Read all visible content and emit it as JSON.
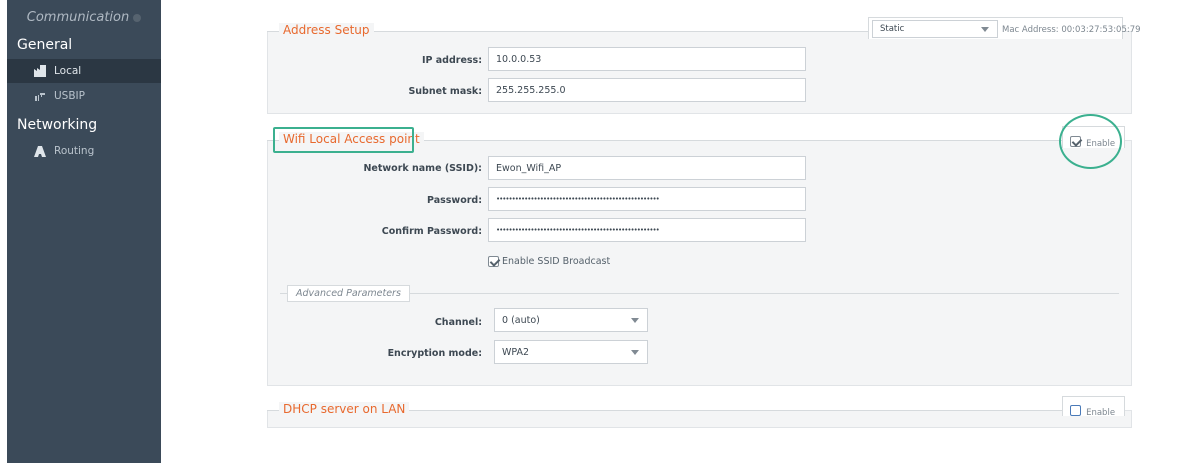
{
  "sidebar": {
    "title": "Communication",
    "sections": [
      {
        "label": "General",
        "items": [
          {
            "label": "Local",
            "icon": "factory-icon",
            "active": true
          },
          {
            "label": "USBIP",
            "icon": "usb-icon",
            "active": false
          }
        ]
      },
      {
        "label": "Networking",
        "items": [
          {
            "label": "Routing",
            "icon": "routing-icon",
            "active": false
          }
        ]
      }
    ]
  },
  "address_setup": {
    "title": "Address Setup",
    "mode": "Static",
    "mac": "Mac Address: 00:03:27:53:05:79",
    "ip_label": "IP address:",
    "ip_value": "10.0.0.53",
    "mask_label": "Subnet mask:",
    "mask_value": "255.255.255.0"
  },
  "wifi": {
    "title": "Wifi Local Access point",
    "enable_label": "Enable",
    "ssid_label": "Network name (SSID):",
    "ssid_value": "Ewon_Wifi_AP",
    "pwd_label": "Password:",
    "pwd_value": "••••••••••••••••••••••••••••••••••••••••••••••••••••",
    "confirm_label": "Confirm Password:",
    "confirm_value": "••••••••••••••••••••••••••••••••••••••••••••••••••••",
    "broadcast_label": "Enable SSID Broadcast",
    "advanced_title": "Advanced Parameters",
    "channel_label": "Channel:",
    "channel_value": "0 (auto)",
    "encryption_label": "Encryption mode:",
    "encryption_value": "WPA2"
  },
  "dhcp": {
    "title": "DHCP server on LAN",
    "enable_label": "Enable"
  },
  "colors": {
    "accent": "#e8692e",
    "highlight": "#3bb08f",
    "sidebar": "#3b4a59"
  }
}
